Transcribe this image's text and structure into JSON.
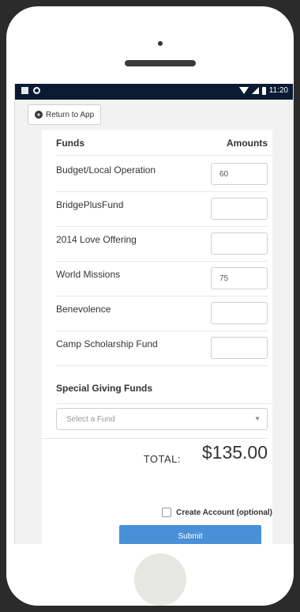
{
  "statusbar": {
    "time": "11:20"
  },
  "nav": {
    "return_label": "Return to App"
  },
  "form": {
    "header_funds": "Funds",
    "header_amounts": "Amounts",
    "funds": [
      {
        "label": "Budget/Local Operation",
        "value": "60"
      },
      {
        "label": "BridgePlusFund",
        "value": ""
      },
      {
        "label": "2014 Love Offering",
        "value": ""
      },
      {
        "label": "World Missions",
        "value": "75"
      },
      {
        "label": "Benevolence",
        "value": ""
      },
      {
        "label": "Camp Scholarship Fund",
        "value": ""
      }
    ],
    "special_title": "Special Giving Funds",
    "select_placeholder": "Select a Fund",
    "total_label": "TOTAL:",
    "total_value": "$135.00",
    "create_account_label": "Create Account (optional)",
    "submit_label": "Submit"
  },
  "icons": {
    "return": "plus-circle-icon",
    "select": "chevron-down-icon"
  },
  "colors": {
    "statusbar_bg": "#0b1a33",
    "submit_bg": "#4a90d9"
  }
}
